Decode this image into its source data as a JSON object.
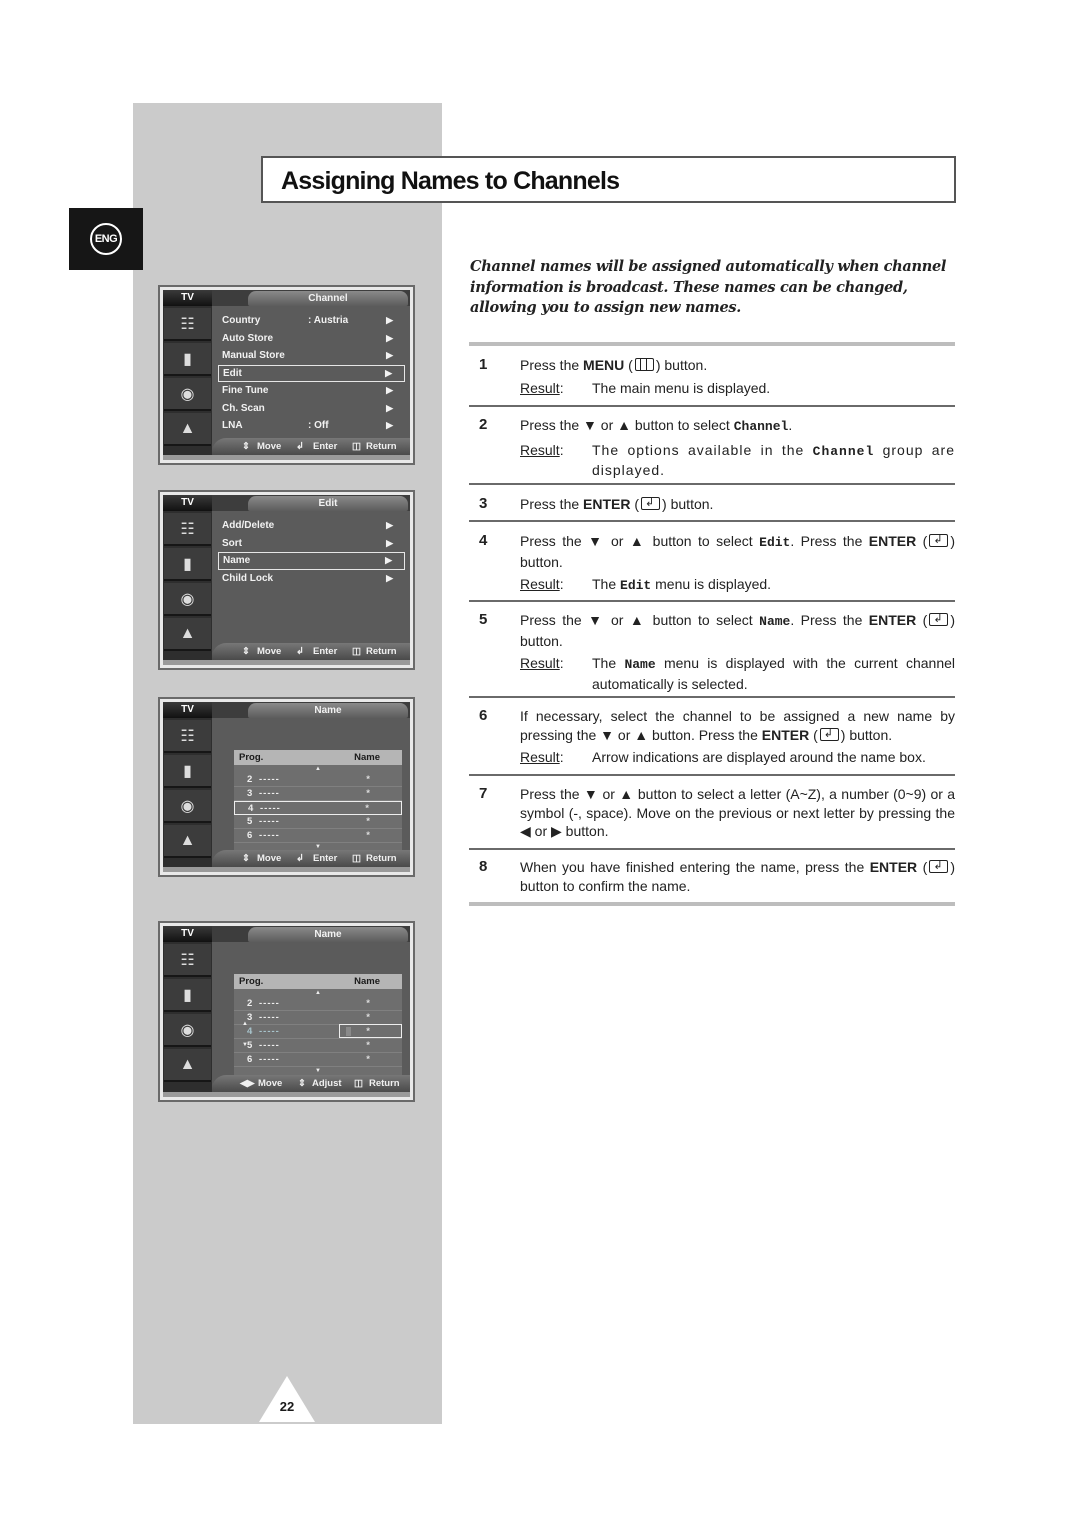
{
  "page": {
    "title": "Assigning Names to Channels",
    "language_tab": "ENG",
    "page_number": "22",
    "intro": "Channel names will be assigned automatically when channel information is broadcast. These names can be changed, allowing you to assign new names."
  },
  "osd_common": {
    "tv_label": "TV",
    "side_icons": [
      "input-icon",
      "picture-icon",
      "sound-icon",
      "channel-icon",
      "setup-icon"
    ]
  },
  "osd_channel": {
    "title": "Channel",
    "items": [
      {
        "label": "Country",
        "value": ": Austria",
        "selected": false
      },
      {
        "label": "Auto Store",
        "value": "",
        "selected": false
      },
      {
        "label": "Manual Store",
        "value": "",
        "selected": false
      },
      {
        "label": "Edit",
        "value": "",
        "selected": true
      },
      {
        "label": "Fine Tune",
        "value": "",
        "selected": false
      },
      {
        "label": "Ch. Scan",
        "value": "",
        "selected": false
      },
      {
        "label": "LNA",
        "value": ": Off",
        "selected": false
      }
    ],
    "footer": {
      "move": "Move",
      "enter": "Enter",
      "return": "Return"
    }
  },
  "osd_edit": {
    "title": "Edit",
    "items": [
      {
        "label": "Add/Delete",
        "selected": false
      },
      {
        "label": "Sort",
        "selected": false
      },
      {
        "label": "Name",
        "selected": true
      },
      {
        "label": "Child Lock",
        "selected": false
      }
    ],
    "footer": {
      "move": "Move",
      "enter": "Enter",
      "return": "Return"
    }
  },
  "osd_name1": {
    "title": "Name",
    "col_prog": "Prog.",
    "col_name": "Name",
    "rows": [
      {
        "prog": "2",
        "dashes": "-----",
        "name": "*"
      },
      {
        "prog": "3",
        "dashes": "-----",
        "name": "*"
      },
      {
        "prog": "4",
        "dashes": "-----",
        "name": "*"
      },
      {
        "prog": "5",
        "dashes": "-----",
        "name": "*"
      },
      {
        "prog": "6",
        "dashes": "-----",
        "name": "*"
      }
    ],
    "selected_prog": "4",
    "footer": {
      "move": "Move",
      "enter": "Enter",
      "return": "Return"
    }
  },
  "osd_name2": {
    "title": "Name",
    "col_prog": "Prog.",
    "col_name": "Name",
    "rows": [
      {
        "prog": "2",
        "dashes": "-----",
        "name": "*"
      },
      {
        "prog": "3",
        "dashes": "-----",
        "name": "*"
      },
      {
        "prog": "4",
        "dashes": "-----",
        "name": "*"
      },
      {
        "prog": "5",
        "dashes": "-----",
        "name": "*"
      },
      {
        "prog": "6",
        "dashes": "-----",
        "name": "*"
      }
    ],
    "editing_prog": "4",
    "footer": {
      "move": "Move",
      "adjust": "Adjust",
      "return": "Return"
    }
  },
  "steps": [
    {
      "num": "1",
      "result_label": "Result",
      "result": "The main menu is displayed."
    },
    {
      "num": "2",
      "result_label": "Result",
      "result_pre": "The options available in the ",
      "result_code": "Channel",
      "result_post": " group are displayed."
    },
    {
      "num": "3"
    },
    {
      "num": "4",
      "result_label": "Result",
      "result_pre": "The ",
      "result_code": "Edit",
      "result_post": " menu is displayed."
    },
    {
      "num": "5",
      "result_label": "Result",
      "result_pre": "The ",
      "result_code": "Name",
      "result_post": " menu is displayed with the current channel automatically is selected."
    },
    {
      "num": "6",
      "result_label": "Result",
      "result": "Arrow indications are displayed around the name box."
    },
    {
      "num": "7"
    },
    {
      "num": "8"
    }
  ],
  "text": {
    "press_the": "Press the ",
    "menu": "MENU",
    "enter": "ENTER",
    "button_dot": " button.",
    "button": "button.",
    "or": " or ",
    "btn_select": " button to select ",
    "press_enter_sep": ". Press the ",
    "channel_code": "Channel",
    "edit_code": "Edit",
    "name_code": "Name",
    "s6_a": "If necessary, select the channel to be assigned a new name by pressing the ",
    "s6_b": " button. Press the ",
    "s7_a": " button to select a letter (A~Z), a number (0~9) or a symbol (-, space). Move on the previous or next letter by pressing the ",
    "s8_a": "When you have finished entering the name, press the ",
    "s8_b": " button to confirm the name."
  }
}
